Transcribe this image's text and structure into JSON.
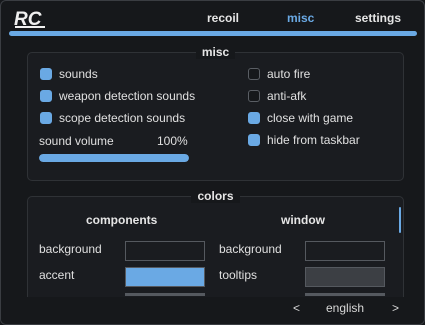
{
  "app": {
    "logo_text": "RC"
  },
  "tabs": [
    {
      "label": "recoil",
      "active": false
    },
    {
      "label": "misc",
      "active": true
    },
    {
      "label": "settings",
      "active": false
    }
  ],
  "misc": {
    "title": "misc",
    "left_options": [
      {
        "label": "sounds",
        "checked": true
      },
      {
        "label": "weapon detection sounds",
        "checked": true
      },
      {
        "label": "scope detection sounds",
        "checked": true
      }
    ],
    "right_options": [
      {
        "label": "auto fire",
        "checked": false
      },
      {
        "label": "anti-afk",
        "checked": false
      },
      {
        "label": "close with game",
        "checked": true
      },
      {
        "label": "hide from taskbar",
        "checked": true
      }
    ],
    "sound_volume": {
      "label": "sound volume",
      "value_text": "100%",
      "fraction": 1.0
    }
  },
  "colors": {
    "title": "colors",
    "components": {
      "heading": "components",
      "rows": [
        {
          "label": "background",
          "color": "#1a1c20"
        },
        {
          "label": "accent",
          "color": "#6aa9e4"
        }
      ]
    },
    "window": {
      "heading": "window",
      "rows": [
        {
          "label": "background",
          "color": "#1a1c20"
        },
        {
          "label": "tooltips",
          "color": "#3c3f44"
        }
      ]
    }
  },
  "footer": {
    "prev": "<",
    "language": "english",
    "next": ">"
  },
  "theme": {
    "accent": "#6aa9e4",
    "background": "#16181b"
  }
}
